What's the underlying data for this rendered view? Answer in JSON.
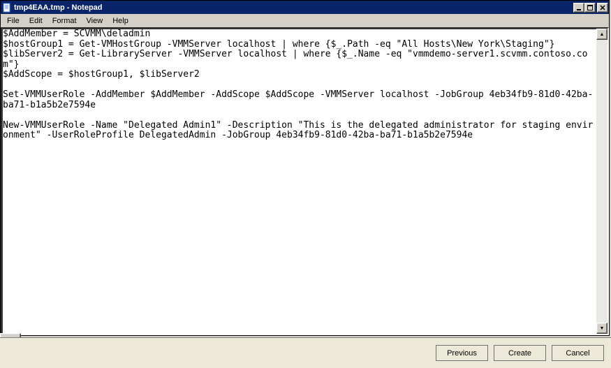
{
  "window": {
    "title": "tmp4EAA.tmp - Notepad",
    "controls": {
      "minimize_glyph": "_",
      "maximize_glyph": "❐",
      "close_glyph": "✕"
    }
  },
  "menu": {
    "items": [
      "File",
      "Edit",
      "Format",
      "View",
      "Help"
    ]
  },
  "editor": {
    "content": "$AddMember = SCVMM\\deladmin\n$hostGroup1 = Get-VMHostGroup -VMMServer localhost | where {$_.Path -eq \"All Hosts\\New York\\Staging\"}\n$libServer2 = Get-LibraryServer -VMMServer localhost | where {$_.Name -eq \"vmmdemo-server1.scvmm.contoso.com\"}\n$AddScope = $hostGroup1, $libServer2\n\nSet-VMMUserRole -AddMember $AddMember -AddScope $AddScope -VMMServer localhost -JobGroup 4eb34fb9-81d0-42ba-ba71-b1a5b2e7594e\n\nNew-VMMUserRole -Name \"Delegated Admin1\" -Description \"This is the delegated administrator for staging environment\" -UserRoleProfile DelegatedAdmin -JobGroup 4eb34fb9-81d0-42ba-ba71-b1a5b2e7594e"
  },
  "scrollbar": {
    "up_glyph": "▲",
    "down_glyph": "▼"
  },
  "wizard_buttons": {
    "previous": "Previous",
    "create": "Create",
    "cancel": "Cancel"
  }
}
